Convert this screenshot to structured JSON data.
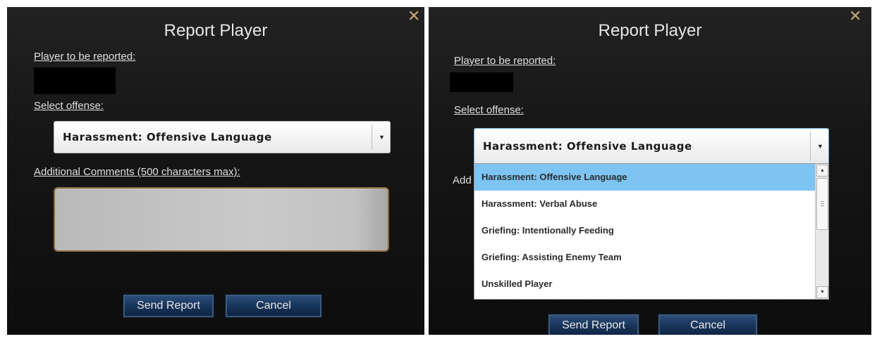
{
  "left": {
    "title": "Report Player",
    "close_glyph": "✕",
    "player_label": "Player to be reported:",
    "offense_label": "Select offense:",
    "offense_value": "Harassment: Offensive Language",
    "comments_label": "Additional Comments (500 characters max):",
    "send_label": "Send Report",
    "cancel_label": "Cancel"
  },
  "right": {
    "title": "Report Player",
    "close_glyph": "✕",
    "player_label": "Player to be reported:",
    "offense_label": "Select offense:",
    "offense_value": "Harassment: Offensive Language",
    "comments_label_partial": "Add",
    "send_label": "Send Report",
    "cancel_label": "Cancel",
    "options": [
      {
        "label": "Harassment: Offensive Language",
        "selected": true
      },
      {
        "label": "Harassment: Verbal Abuse",
        "selected": false
      },
      {
        "label": "Griefing: Intentionally Feeding",
        "selected": false
      },
      {
        "label": "Griefing: Assisting Enemy Team",
        "selected": false
      },
      {
        "label": "Unskilled Player",
        "selected": false
      }
    ]
  },
  "icons": {
    "close": "close-icon",
    "dropdown_arrow": "chevron-down-icon",
    "scroll_up": "scroll-up-icon",
    "scroll_down": "scroll-down-icon"
  },
  "colors": {
    "panel_bg": "#161616",
    "title_text": "#e6e6e6",
    "close_icon": "#c9aa71",
    "button_bg": "#173357",
    "selected_option": "#7dc4f3",
    "textarea_border": "#8a6a3c"
  }
}
